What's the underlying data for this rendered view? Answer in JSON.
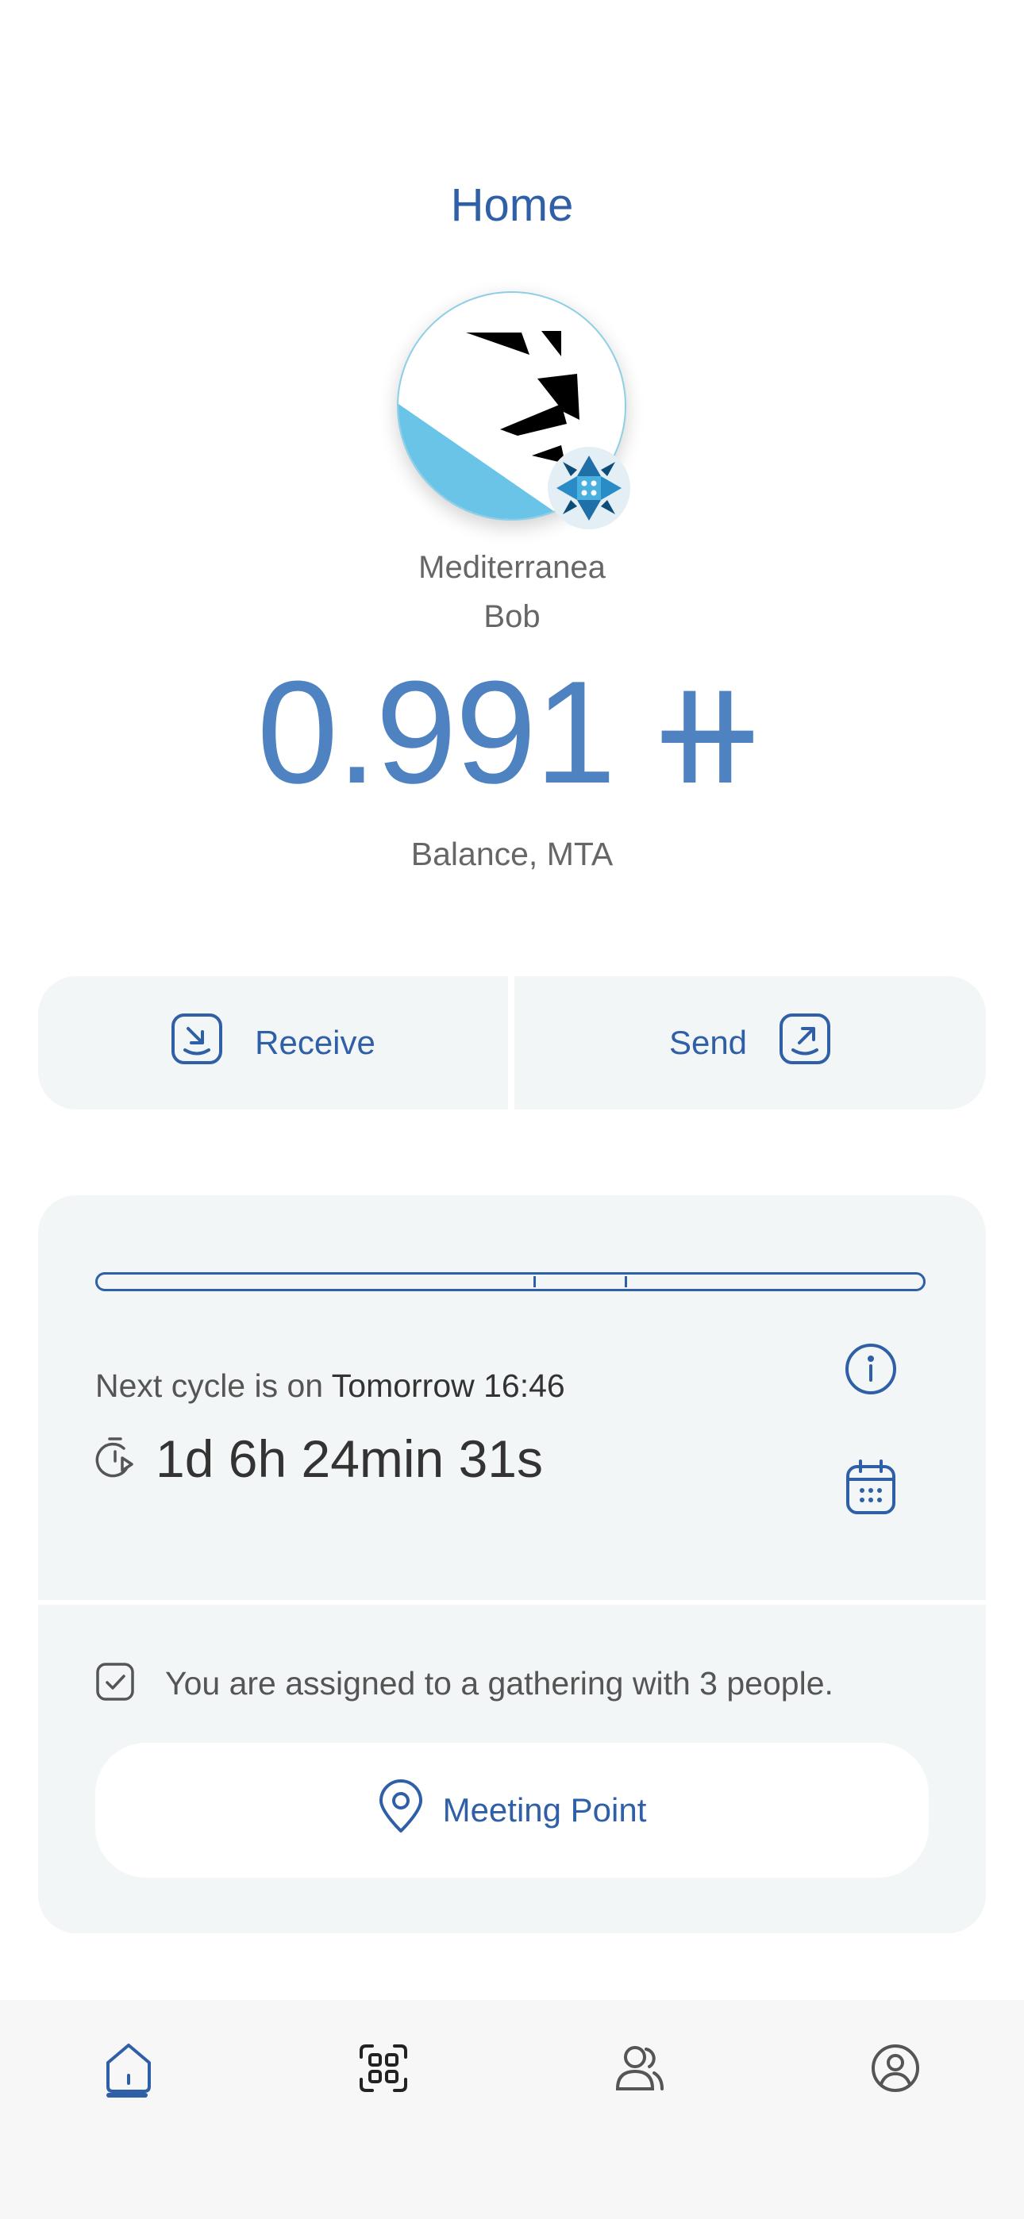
{
  "header": {
    "title": "Home"
  },
  "community": {
    "name": "Mediterranea",
    "username": "Bob"
  },
  "balance": {
    "value": "0.991",
    "symbol": "⧺",
    "label": "Balance, MTA"
  },
  "actions": {
    "receive_label": "Receive",
    "send_label": "Send"
  },
  "cycle": {
    "next_prefix": "Next cycle is on",
    "next_value": "Tomorrow 16:46",
    "countdown": "1d 6h 24min 31s"
  },
  "gathering": {
    "text": "You are assigned to a gathering with 3 people.",
    "meeting_label": "Meeting Point"
  },
  "colors": {
    "accent": "#2f5fa6",
    "balance": "#4f82c0",
    "card_bg": "#f3f6f7",
    "avatar_blue": "#6ac4e8"
  },
  "nav": {
    "items": [
      "home-icon",
      "qr-scan-icon",
      "contacts-icon",
      "profile-icon"
    ],
    "active": "home-icon"
  }
}
